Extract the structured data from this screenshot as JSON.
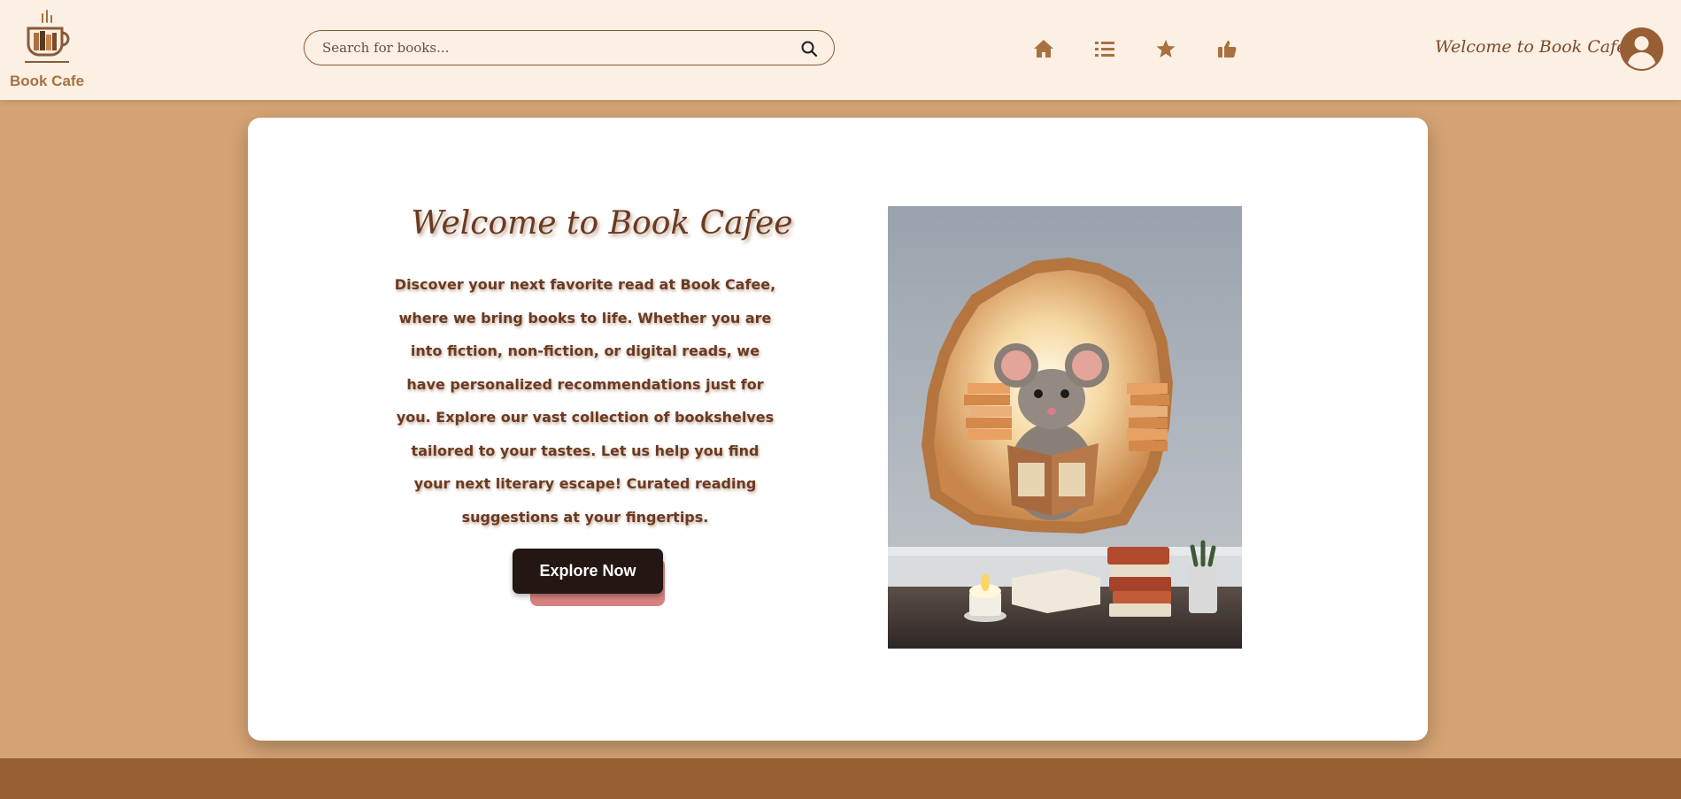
{
  "brand": {
    "name": "Book Cafe"
  },
  "search": {
    "placeholder": "Search for books..."
  },
  "nav": {
    "icons": [
      "home-icon",
      "list-icon",
      "star-icon",
      "thumbs-up-icon"
    ]
  },
  "header": {
    "greeting": "Welcome to Book Cafe"
  },
  "hero": {
    "title": "Welcome to Book Cafee",
    "description": "Discover your next favorite read at Book Cafee, where we bring books to life. Whether you are into fiction, non-fiction, or digital reads, we have personalized recommendations just for you. Explore our vast collection of bookshelves tailored to your tastes. Let us help you find your next literary escape! Curated reading suggestions at your fingertips.",
    "button_label": "Explore Now"
  },
  "colors": {
    "header_bg": "#fcefe3",
    "page_bg": "#d4a373",
    "accent_brown": "#985e34",
    "text_brown": "#6b3a22",
    "button_bg": "#231613"
  }
}
